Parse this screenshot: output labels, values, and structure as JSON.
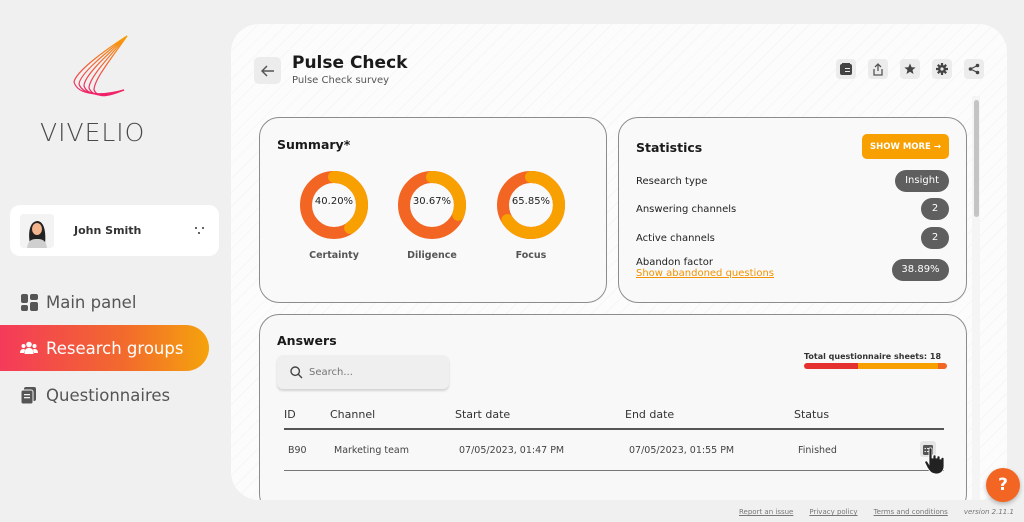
{
  "brand": {
    "name": "VIVELIO"
  },
  "user": {
    "name": "John Smith",
    "avatar_icon": "user-avatar-icon",
    "menu_icon": "dots-icon"
  },
  "sidebar": {
    "items": [
      {
        "label": "Main panel",
        "icon": "dashboard-icon",
        "active": false
      },
      {
        "label": "Research groups",
        "icon": "users-icon",
        "active": true
      },
      {
        "label": "Questionnaires",
        "icon": "document-stack-icon",
        "active": false
      }
    ]
  },
  "header": {
    "title": "Pulse Check",
    "subtitle": "Pulse Check survey",
    "back_icon": "arrow-left-icon",
    "toolbar": [
      "report-icon",
      "export-icon",
      "star-icon",
      "gear-icon",
      "share-icon"
    ]
  },
  "summary": {
    "title": "Summary*",
    "metrics": [
      {
        "label": "Certainty",
        "value": "40.20%",
        "percent": 40.2
      },
      {
        "label": "Diligence",
        "value": "30.67%",
        "percent": 30.67
      },
      {
        "label": "Focus",
        "value": "65.85%",
        "percent": 65.85
      }
    ],
    "colors": {
      "fill": "#f8a000",
      "rest": "#f26522"
    }
  },
  "statistics": {
    "title": "Statistics",
    "show_more_label": "SHOW MORE →",
    "rows": [
      {
        "label": "Research type",
        "value": "Insight"
      },
      {
        "label": "Answering channels",
        "value": "2"
      },
      {
        "label": "Active channels",
        "value": "2"
      },
      {
        "label": "Abandon factor",
        "value": "38.89%"
      }
    ],
    "abandoned_link": "Show abandoned questions"
  },
  "answers": {
    "title": "Answers",
    "search_placeholder": "Search...",
    "total_label": "Total questionnaire sheets: 18",
    "progress": [
      {
        "name": "segment-1",
        "fraction": 0.38,
        "color": "#e53030"
      },
      {
        "name": "segment-2",
        "fraction": 0.56,
        "color": "#f8a000"
      },
      {
        "name": "segment-3",
        "fraction": 0.06,
        "color": "#f26522"
      }
    ],
    "columns": [
      "ID",
      "Channel",
      "Start date",
      "End date",
      "Status"
    ],
    "rows": [
      {
        "id": "B90",
        "channel": "Marketing team",
        "start": "07/05/2023, 01:47 PM",
        "end": "07/05/2023, 01:55 PM",
        "status": "Finished"
      }
    ]
  },
  "footer": {
    "links": [
      "Report an issue",
      "Privacy policy",
      "Terms and conditions"
    ],
    "version": "version 2.11.1"
  },
  "help_label": "?"
}
